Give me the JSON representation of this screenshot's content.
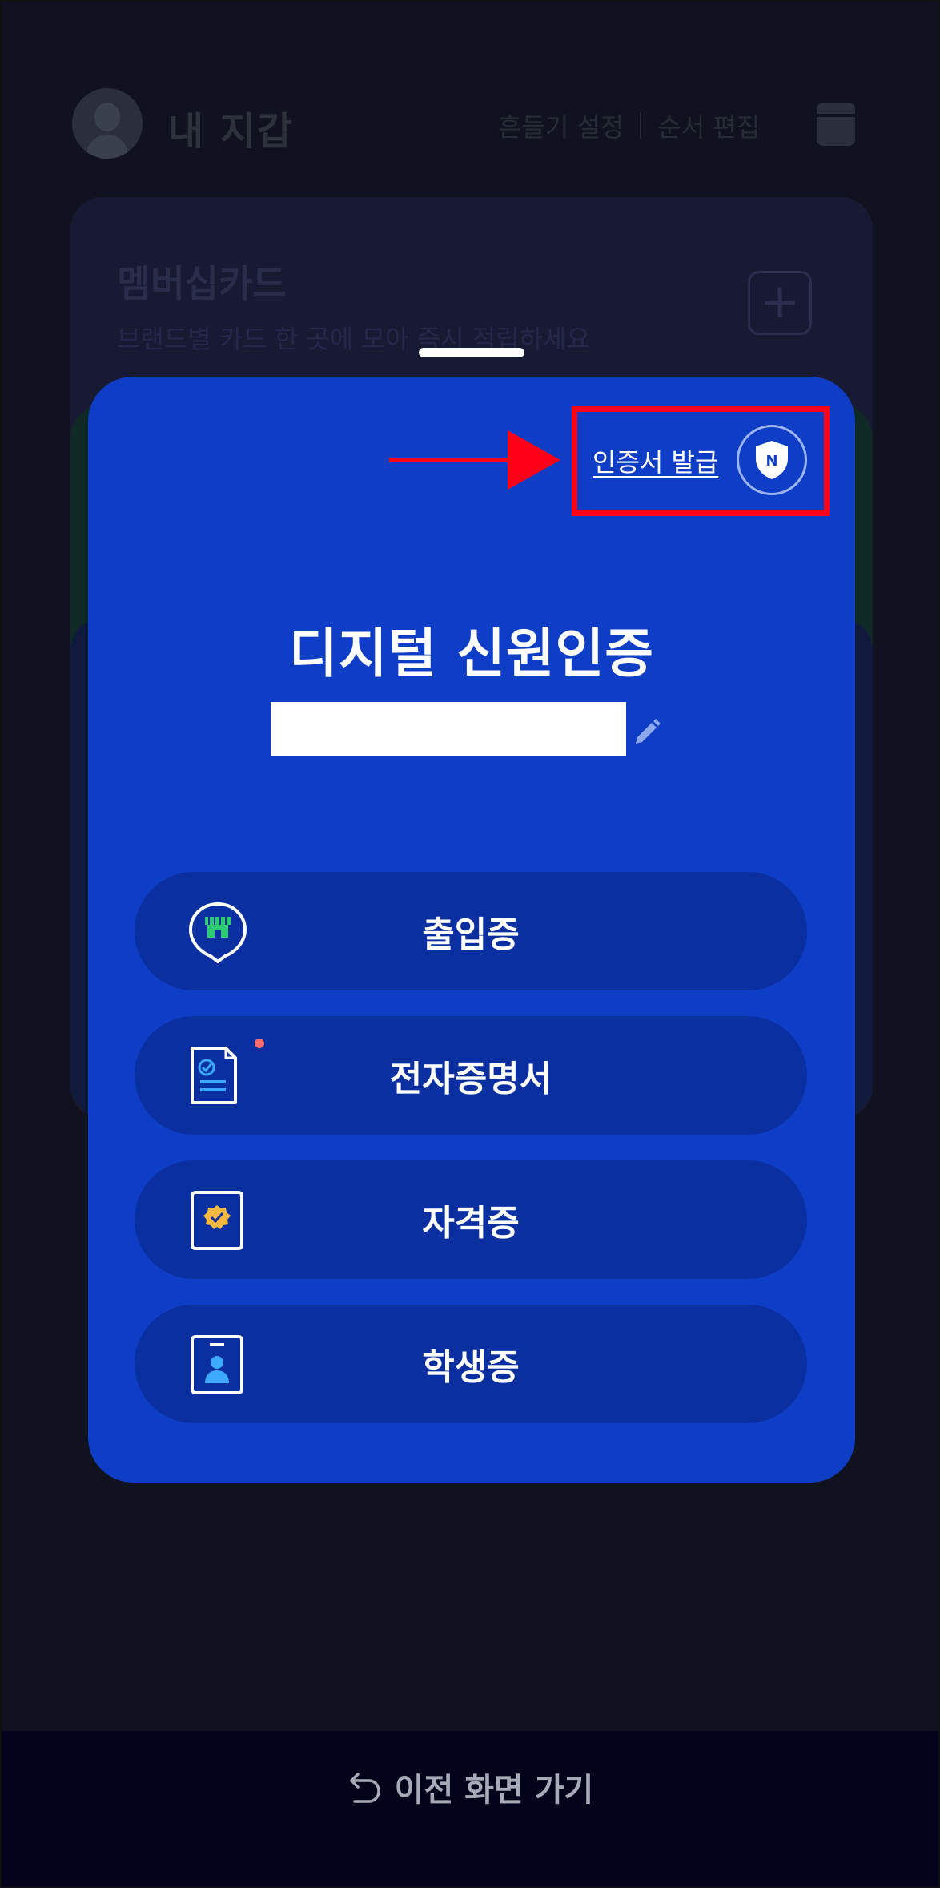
{
  "header": {
    "title": "내 지갑",
    "shake_setting": "흔들기 설정",
    "reorder": "순서 편집"
  },
  "background_card": {
    "title": "멤버십카드",
    "subtitle": "브랜드별 카드 한 곳에 모아 즉시 적립하세요"
  },
  "id_card": {
    "issue_cert_label": "인증서 발급",
    "shield_letter": "N",
    "title": "디지털 신원인증",
    "name_value": "",
    "menu": [
      {
        "label": "출입증",
        "icon": "building-pin-icon"
      },
      {
        "label": "전자증명서",
        "icon": "document-check-icon"
      },
      {
        "label": "자격증",
        "icon": "badge-certificate-icon"
      },
      {
        "label": "학생증",
        "icon": "student-id-icon"
      }
    ]
  },
  "footer": {
    "back_label": "이전 화면 가기"
  },
  "colors": {
    "card_blue": "#0d3ec5",
    "button_blue": "#0a2fa0",
    "annotation_red": "#ff0018",
    "notification_dot": "#ff6b6b"
  }
}
